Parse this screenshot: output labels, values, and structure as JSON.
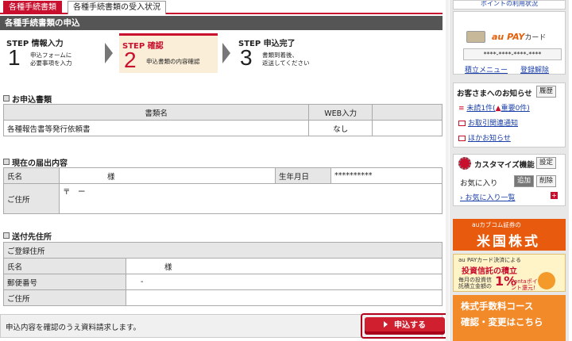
{
  "tabs": {
    "active": "各種手続書類",
    "inactive": "各種手続書類の受入状況"
  },
  "page_title": "各種手続書類の申込",
  "steps": [
    {
      "label": "STEP 情報入力",
      "num": "1",
      "desc1": "申込フォームに",
      "desc2": "必要事項を入力"
    },
    {
      "label": "STEP 確認",
      "num": "2",
      "desc1": "申込書類の内容確認",
      "desc2": ""
    },
    {
      "label": "STEP 申込完了",
      "num": "3",
      "desc1": "書類到着後、",
      "desc2": "返送してください"
    }
  ],
  "docs": {
    "heading": "お申込書類",
    "col_name": "書類名",
    "col_web": "WEB入力",
    "row_name": "各種報告書等発行依頼書",
    "row_web": "なし"
  },
  "current": {
    "heading": "現在の届出内容",
    "name_label": "氏名",
    "name_value": "様",
    "birth_label": "生年月日",
    "birth_value": "**********",
    "addr_label": "ご住所",
    "addr_value": "〒　ー"
  },
  "send": {
    "heading": "送付先住所",
    "subhead": "ご登録住所",
    "name_label": "氏名",
    "name_value": "様",
    "zip_label": "郵便番号",
    "zip_value": "-",
    "addr_label": "ご住所",
    "addr_value": ""
  },
  "confirm_text": "申込内容を確認のうえ資料請求します。",
  "submit_label": "申込する",
  "sidebar": {
    "top_link": "ポイントの利用状況",
    "au_brand": "au PAY",
    "au_card": "カード",
    "card_number": "****-****-****-****",
    "menu_link": "積立メニュー",
    "cancel_link": "登録解除",
    "notice_heading": "お客さまへのお知らせ",
    "history_btn": "履歴",
    "unread": "未読1件(",
    "important": "重要0件)",
    "trade_notice": "お取引関連通知",
    "other_notice": "ほかお知らせ",
    "customize": "カスタマイズ機能",
    "settings_btn": "設定",
    "favorites": "お気に入り",
    "add_btn": "追加",
    "delete_btn": "削除",
    "fav_list": "お気に入り一覧",
    "banner1_small": "auカブコム証券の",
    "banner1_big": "米国株式",
    "banner2_small": "au PAYカード決済による",
    "banner2_big": "投資信託の積立",
    "banner2_text": "毎月の投資信託積立金額の",
    "banner2_pct": "1%",
    "banner2_tail": "Pontaポイント還元!",
    "banner3_line1": "株式手数料コース",
    "banner3_line2": "確認・変更はこちら"
  },
  "colors": {
    "accent": "#c8102e",
    "title_bar": "#555555",
    "step_active_bg": "#fbeed8",
    "banner_orange": "#e85a0e"
  }
}
